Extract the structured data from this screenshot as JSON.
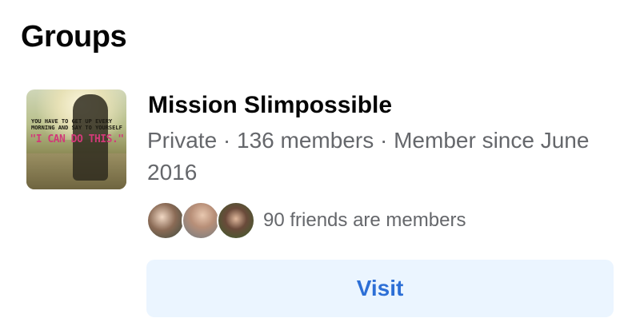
{
  "section": {
    "title": "Groups"
  },
  "group": {
    "name": "Mission Slimpossible",
    "meta": "Private · 136 members · Member since June 2016",
    "thumbnail": {
      "caption_small": "YOU HAVE TO GET UP EVERY MORNING AND SAY TO YOURSELF",
      "caption_large": "\"I CAN DO THIS.\""
    },
    "friends_text": "90 friends are members",
    "friend_avatars": [
      "friend-avatar-1",
      "friend-avatar-2",
      "friend-avatar-3"
    ]
  },
  "actions": {
    "visit_label": "Visit"
  },
  "colors": {
    "button_bg": "#ebf5ff",
    "button_text": "#2d6fd6",
    "secondary_text": "#65676b"
  }
}
